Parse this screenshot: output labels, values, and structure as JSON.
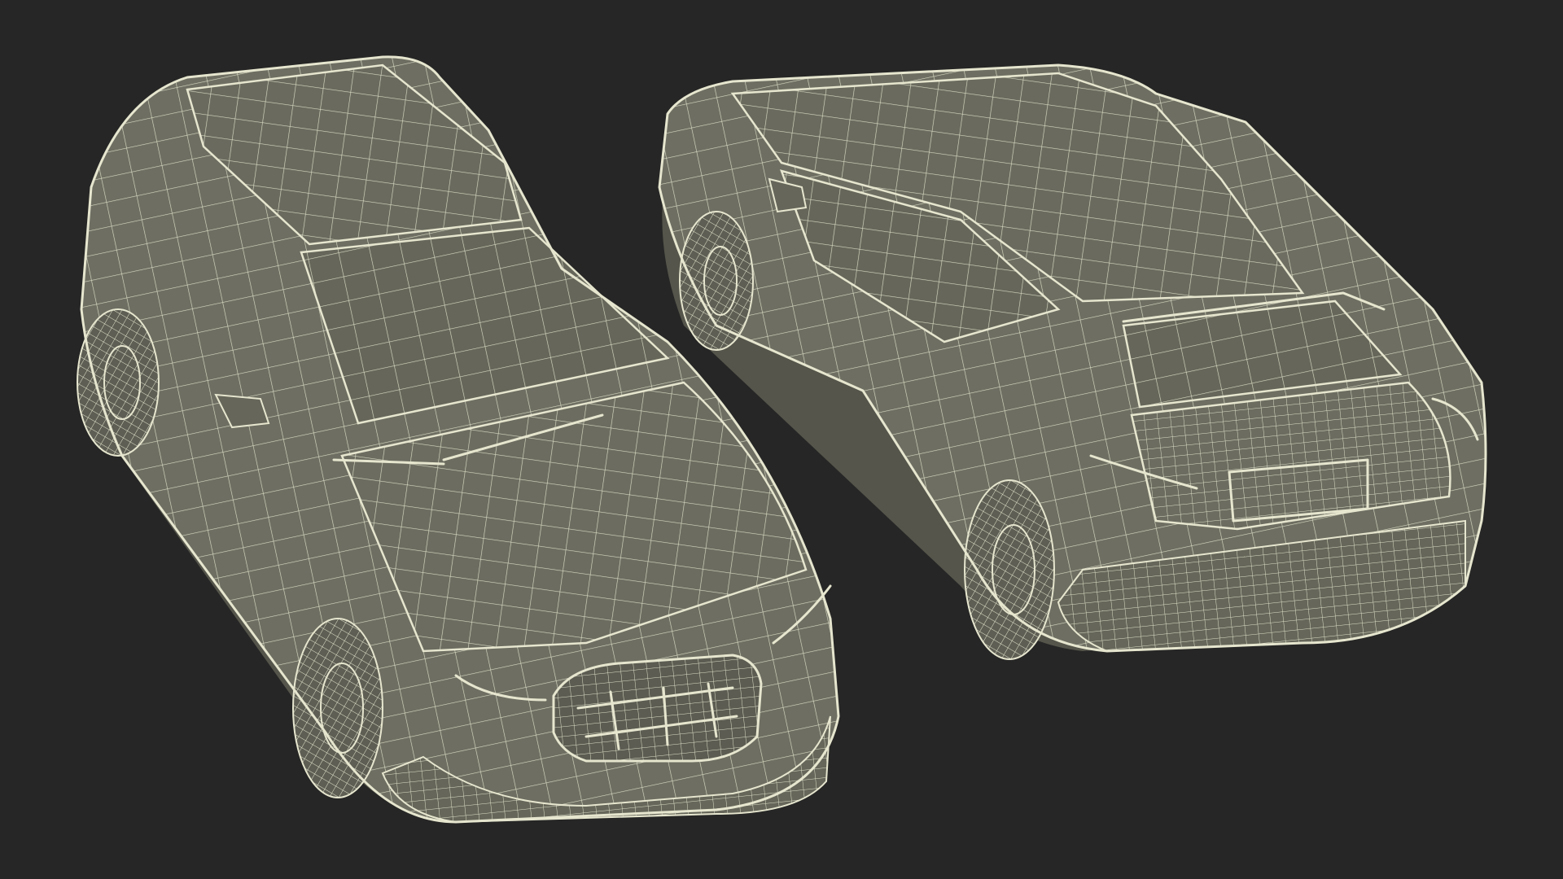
{
  "scene": {
    "background_color": "#262626",
    "wire_color": "#e6e6cf",
    "body_color": "#6e6e62",
    "shadow_color": "#55554b",
    "objects": [
      {
        "id": "car-front-view",
        "description_icon": "wireframe-suv-front-three-quarter"
      },
      {
        "id": "car-rear-view",
        "description_icon": "wireframe-suv-rear-three-quarter"
      }
    ]
  }
}
